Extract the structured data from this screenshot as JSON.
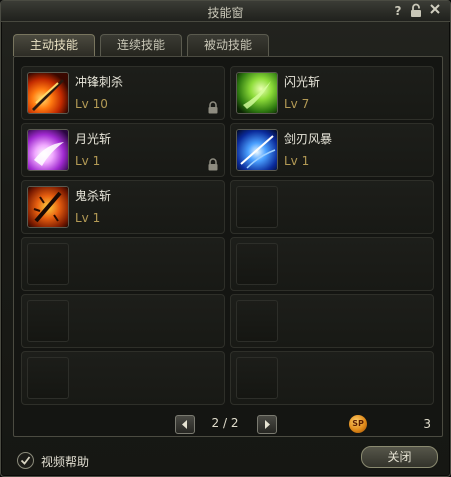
{
  "window": {
    "title": "技能窗",
    "help_glyph": "?"
  },
  "tabs": [
    {
      "label": "主动技能",
      "active": true
    },
    {
      "label": "连续技能",
      "active": false
    },
    {
      "label": "被动技能",
      "active": false
    }
  ],
  "skills": [
    {
      "name": "冲锋刺杀",
      "level": "Lv 10",
      "icon": "charge-stab-icon",
      "locked": true
    },
    {
      "name": "闪光斩",
      "level": "Lv 7",
      "icon": "flash-slash-icon",
      "locked": false
    },
    {
      "name": "月光斩",
      "level": "Lv 1",
      "icon": "moonlight-slash-icon",
      "locked": true
    },
    {
      "name": "剑刃风暴",
      "level": "Lv 1",
      "icon": "blade-storm-icon",
      "locked": false
    },
    {
      "name": "鬼杀斩",
      "level": "Lv 1",
      "icon": "ghost-slash-icon",
      "locked": false
    }
  ],
  "pager": {
    "text": "2 / 2"
  },
  "skill_points": {
    "badge": "SP",
    "value": "3"
  },
  "footer": {
    "help_label": "视频帮助",
    "help_checked": true,
    "close_label": "关闭"
  },
  "colors": {
    "level_text": "#b39a55",
    "panel_bg": "#141512",
    "accent_border": "#5a5a4e"
  }
}
